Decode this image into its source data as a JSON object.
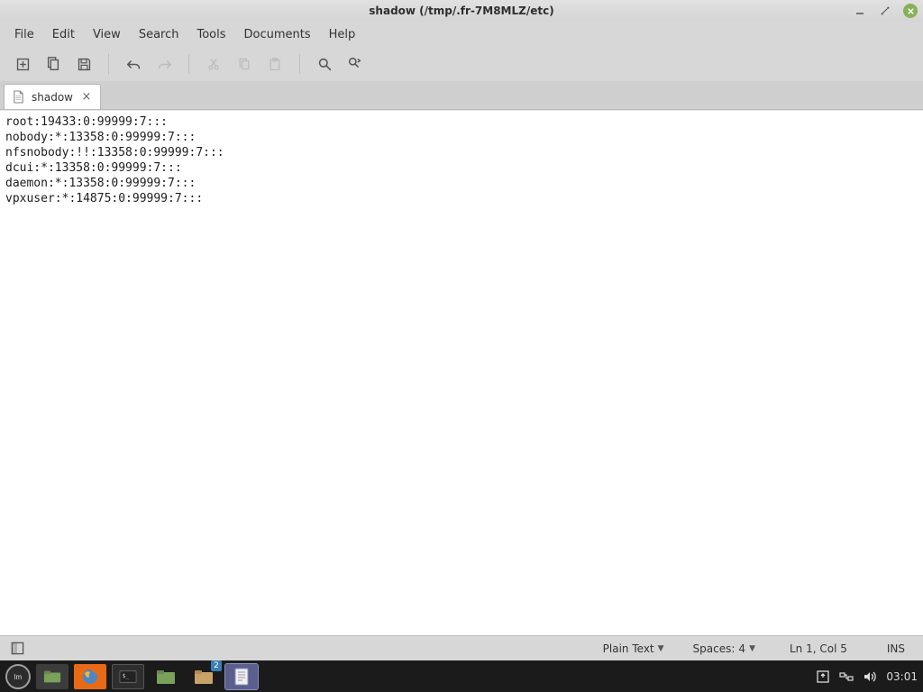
{
  "window": {
    "title": "shadow (/tmp/.fr-7M8MLZ/etc)"
  },
  "menubar": {
    "items": [
      "File",
      "Edit",
      "View",
      "Search",
      "Tools",
      "Documents",
      "Help"
    ]
  },
  "tab": {
    "label": "shadow"
  },
  "editor": {
    "content": "root:19433:0:99999:7:::\nnobody:*:13358:0:99999:7:::\nnfsnobody:!!:13358:0:99999:7:::\ndcui:*:13358:0:99999:7:::\ndaemon:*:13358:0:99999:7:::\nvpxuser:*:14875:0:99999:7:::"
  },
  "statusbar": {
    "syntax": "Plain Text",
    "spaces_label": "Spaces:",
    "spaces_value": "4",
    "position": "Ln 1, Col 5",
    "mode": "INS"
  },
  "taskbar": {
    "badge": "2",
    "clock": "03:01"
  }
}
